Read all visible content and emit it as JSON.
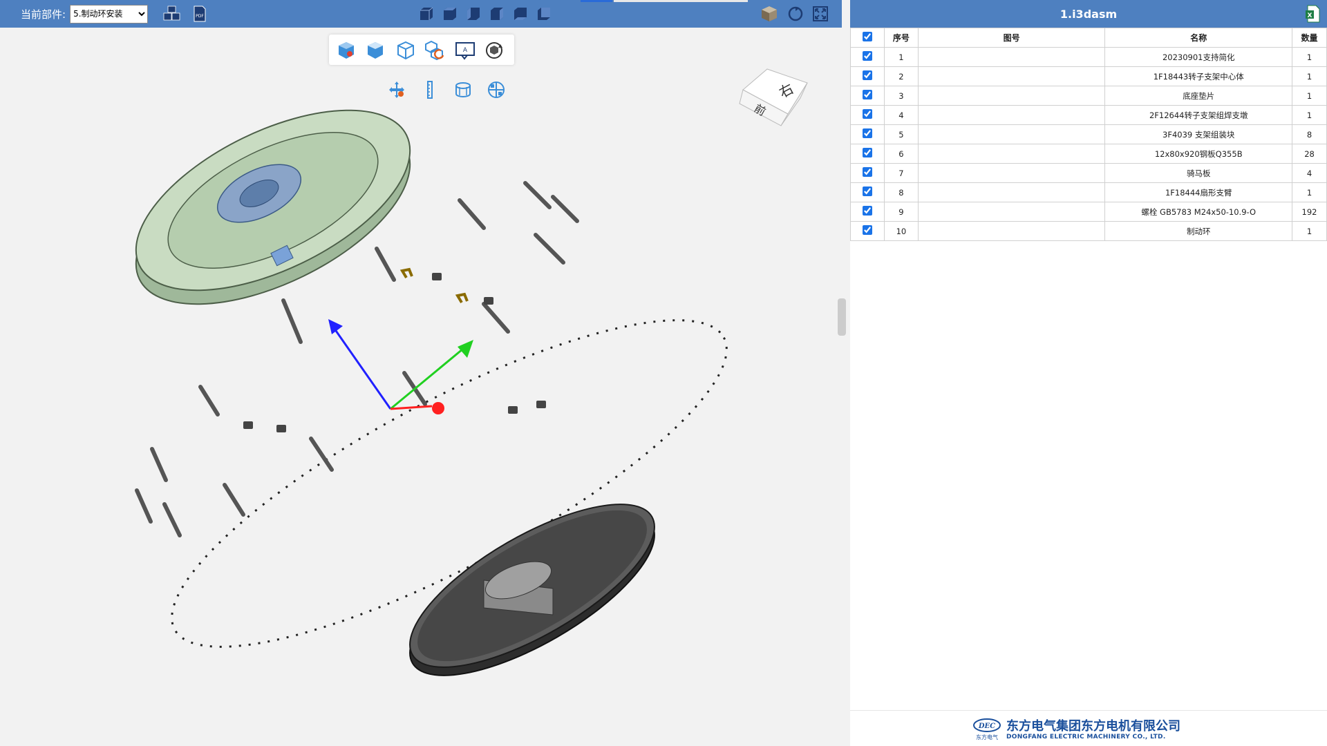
{
  "topbar": {
    "current_part_label": "当前部件:",
    "current_part_value": "5.制动环安装",
    "current_part_options": [
      "5.制动环安装"
    ]
  },
  "panel": {
    "title": "1.i3dasm",
    "columns": [
      "序号",
      "图号",
      "名称",
      "数量"
    ],
    "rows": [
      {
        "no": "1",
        "dwg": "",
        "name": "20230901支持简化",
        "qty": "1"
      },
      {
        "no": "2",
        "dwg": "",
        "name": "1F18443转子支架中心体",
        "qty": "1"
      },
      {
        "no": "3",
        "dwg": "",
        "name": "底座垫片",
        "qty": "1"
      },
      {
        "no": "4",
        "dwg": "",
        "name": "2F12644转子支架组焊支墩",
        "qty": "1"
      },
      {
        "no": "5",
        "dwg": "",
        "name": "3F4039 支架组装块",
        "qty": "8"
      },
      {
        "no": "6",
        "dwg": "",
        "name": "12x80x920钢板Q355B",
        "qty": "28"
      },
      {
        "no": "7",
        "dwg": "",
        "name": "骑马板",
        "qty": "4"
      },
      {
        "no": "8",
        "dwg": "",
        "name": "1F18444扇形支臂",
        "qty": "1"
      },
      {
        "no": "9",
        "dwg": "",
        "name": "螺栓 GB5783 M24x50-10.9-O",
        "qty": "192"
      },
      {
        "no": "10",
        "dwg": "",
        "name": "制动环",
        "qty": "1"
      }
    ]
  },
  "viewcube": {
    "face_right": "右",
    "face_front": "前"
  },
  "footer": {
    "logo_text": "DEC",
    "logo_sub": "东方电气",
    "company_cn": "东方电气集团东方电机有限公司",
    "company_en": "DONGFANG ELECTRIC MACHINERY CO., LTD."
  },
  "colors": {
    "header_blue": "#4e80c0",
    "axis_x": "#ff2020",
    "axis_y": "#20d020",
    "axis_z": "#2020ff",
    "accent_tab": "#2a6bd8"
  }
}
